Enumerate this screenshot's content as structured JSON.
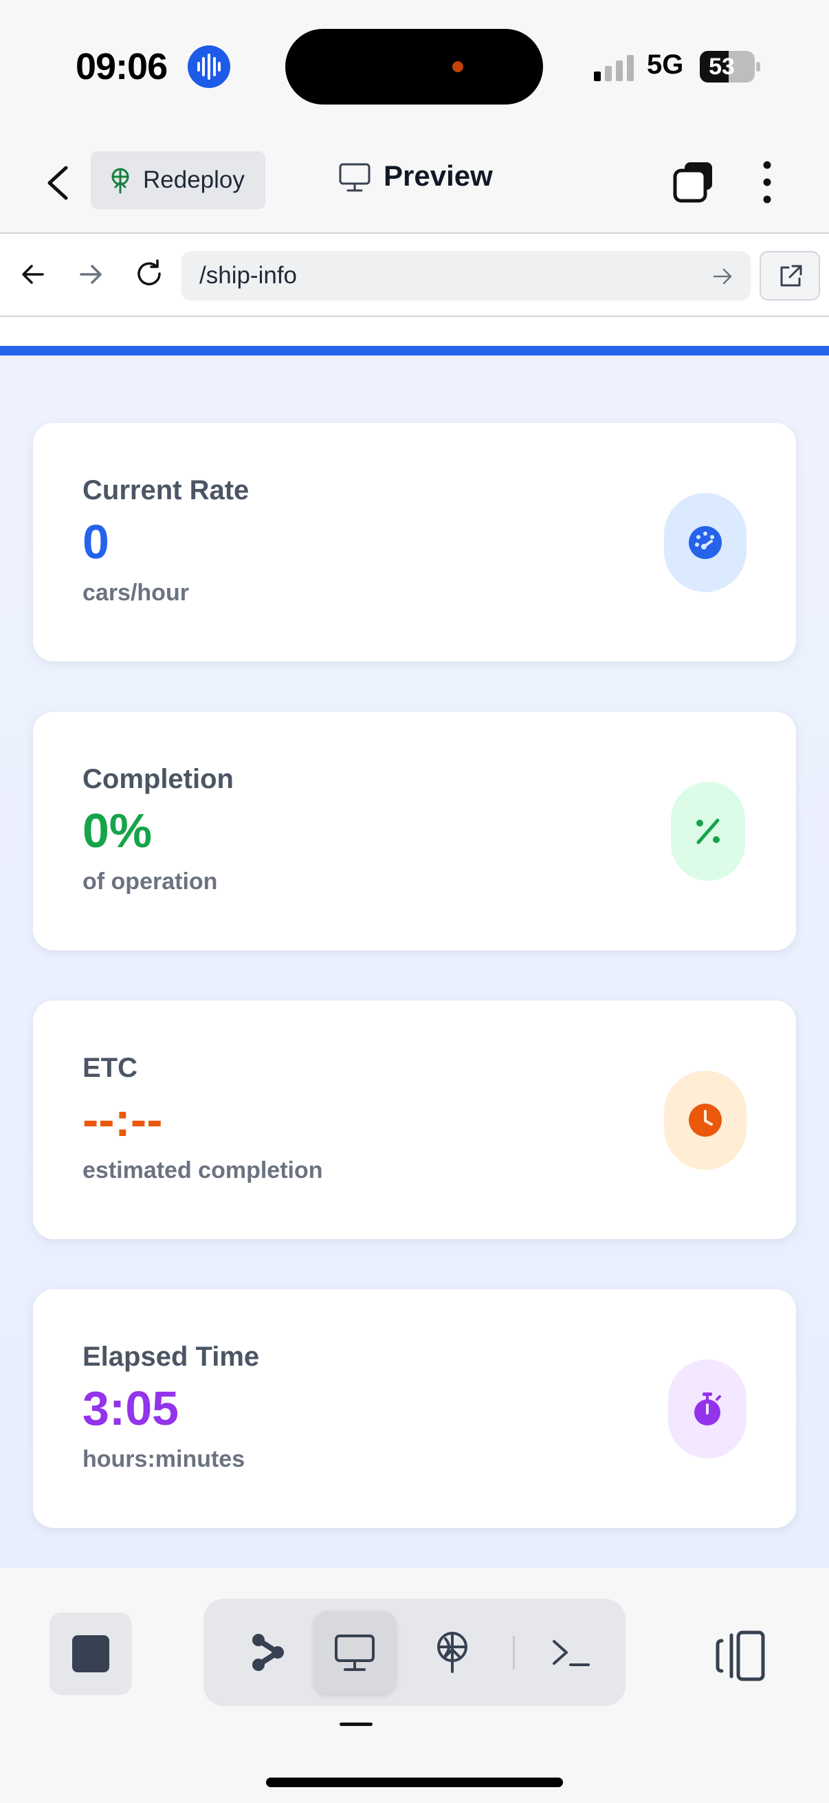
{
  "status_bar": {
    "time": "09:06",
    "network": "5G",
    "battery_percent": "53",
    "battery_level": 0.53
  },
  "top_bar": {
    "redeploy_label": "Redeploy",
    "preview_label": "Preview"
  },
  "browser": {
    "url": "/ship-info"
  },
  "cards": [
    {
      "title": "Current Rate",
      "value": "0",
      "unit": "cars/hour",
      "icon": "gauge-icon",
      "color": "#2563eb",
      "icon_bg": "#dbeafe"
    },
    {
      "title": "Completion",
      "value": "0%",
      "unit": "of operation",
      "icon": "percent-icon",
      "color": "#16a34a",
      "icon_bg": "#dcfce7"
    },
    {
      "title": "ETC",
      "value": "--:--",
      "unit": "estimated completion",
      "icon": "clock-icon",
      "color": "#ea580c",
      "icon_bg": "#ffedd5"
    },
    {
      "title": "Elapsed Time",
      "value": "3:05",
      "unit": "hours:minutes",
      "icon": "stopwatch-icon",
      "color": "#9333ea",
      "icon_bg": "#f3e8ff"
    }
  ],
  "bottom_bar": {
    "icons": [
      "stop-icon",
      "branch-icon",
      "monitor-icon",
      "deploy-icon",
      "terminal-icon",
      "panel-toggle-icon"
    ],
    "active_tab": "monitor-icon"
  }
}
